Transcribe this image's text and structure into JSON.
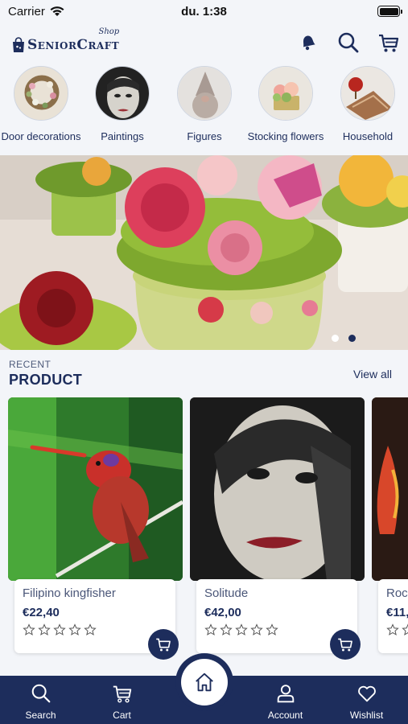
{
  "status": {
    "carrier": "Carrier",
    "time": "du. 1:38"
  },
  "header": {
    "logo_text": "SeniorCraft",
    "logo_tag": "Shop",
    "icons": [
      "bell-icon",
      "search-icon",
      "cart-icon"
    ]
  },
  "categories": [
    {
      "label": "Door decorations",
      "icon": "wreath-thumbnail"
    },
    {
      "label": "Paintings",
      "icon": "painting-thumbnail"
    },
    {
      "label": "Figures",
      "icon": "gnome-thumbnail"
    },
    {
      "label": "Stocking flowers",
      "icon": "flowers-thumbnail"
    },
    {
      "label": "Household",
      "icon": "household-thumbnail"
    }
  ],
  "banner": {
    "slides": 2,
    "active_slide": 2
  },
  "recent": {
    "kicker": "RECENT",
    "title": "PRODUCT",
    "view_all": "View all"
  },
  "products": [
    {
      "name": "Filipino kingfisher",
      "price": "€22,40",
      "rating": 0
    },
    {
      "name": "Solitude",
      "price": "€42,00",
      "rating": 0
    },
    {
      "name": "Rock",
      "price": "€11,",
      "rating": 0
    }
  ],
  "tabs": [
    {
      "label": "Search",
      "icon": "search-icon"
    },
    {
      "label": "Cart",
      "icon": "cart-icon"
    },
    {
      "label": "",
      "icon": "home-icon"
    },
    {
      "label": "Account",
      "icon": "user-icon"
    },
    {
      "label": "Wishlist",
      "icon": "heart-icon"
    }
  ],
  "colors": {
    "primary": "#1d2d5c",
    "background": "#f3f5f9"
  }
}
